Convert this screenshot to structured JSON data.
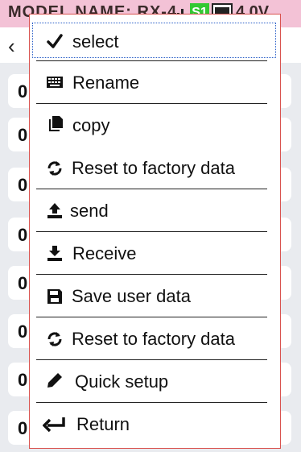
{
  "status_bar": {
    "model_text": "MODEL NAME: RX-4",
    "rx_mode": "S1",
    "voltage": "4.0V"
  },
  "list": {
    "row_prefix": "0"
  },
  "menu": {
    "items": [
      {
        "label": "select",
        "icon": "check-icon"
      },
      {
        "label": "Rename",
        "icon": "keyboard-icon"
      },
      {
        "label": "copy",
        "icon": "copy-icon"
      },
      {
        "label": "Reset to factory data",
        "icon": "refresh-icon"
      },
      {
        "label": "send",
        "icon": "upload-icon"
      },
      {
        "label": "Receive",
        "icon": "download-icon"
      },
      {
        "label": "Save user data",
        "icon": "save-icon"
      },
      {
        "label": "Reset to factory data",
        "icon": "refresh-icon"
      },
      {
        "label": "Quick setup",
        "icon": "pencil-icon"
      },
      {
        "label": "Return",
        "icon": "return-arrow-icon"
      }
    ]
  },
  "colors": {
    "status_bg": "#f3c2d6",
    "menu_border": "#d9534f",
    "selection_border": "#2a5fc8",
    "list_bg": "#e9ebef"
  }
}
